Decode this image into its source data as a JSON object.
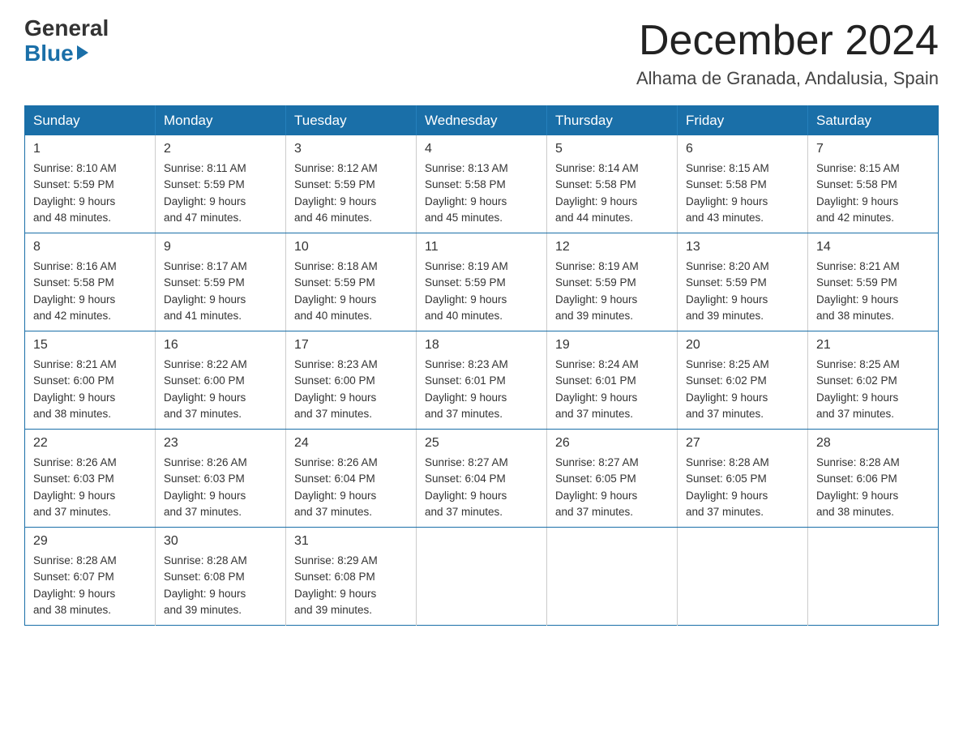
{
  "logo": {
    "line1": "General",
    "line2": "Blue"
  },
  "header": {
    "month": "December 2024",
    "location": "Alhama de Granada, Andalusia, Spain"
  },
  "days_of_week": [
    "Sunday",
    "Monday",
    "Tuesday",
    "Wednesday",
    "Thursday",
    "Friday",
    "Saturday"
  ],
  "weeks": [
    [
      {
        "day": "1",
        "sunrise": "8:10 AM",
        "sunset": "5:59 PM",
        "daylight": "9 hours and 48 minutes."
      },
      {
        "day": "2",
        "sunrise": "8:11 AM",
        "sunset": "5:59 PM",
        "daylight": "9 hours and 47 minutes."
      },
      {
        "day": "3",
        "sunrise": "8:12 AM",
        "sunset": "5:59 PM",
        "daylight": "9 hours and 46 minutes."
      },
      {
        "day": "4",
        "sunrise": "8:13 AM",
        "sunset": "5:58 PM",
        "daylight": "9 hours and 45 minutes."
      },
      {
        "day": "5",
        "sunrise": "8:14 AM",
        "sunset": "5:58 PM",
        "daylight": "9 hours and 44 minutes."
      },
      {
        "day": "6",
        "sunrise": "8:15 AM",
        "sunset": "5:58 PM",
        "daylight": "9 hours and 43 minutes."
      },
      {
        "day": "7",
        "sunrise": "8:15 AM",
        "sunset": "5:58 PM",
        "daylight": "9 hours and 42 minutes."
      }
    ],
    [
      {
        "day": "8",
        "sunrise": "8:16 AM",
        "sunset": "5:58 PM",
        "daylight": "9 hours and 42 minutes."
      },
      {
        "day": "9",
        "sunrise": "8:17 AM",
        "sunset": "5:59 PM",
        "daylight": "9 hours and 41 minutes."
      },
      {
        "day": "10",
        "sunrise": "8:18 AM",
        "sunset": "5:59 PM",
        "daylight": "9 hours and 40 minutes."
      },
      {
        "day": "11",
        "sunrise": "8:19 AM",
        "sunset": "5:59 PM",
        "daylight": "9 hours and 40 minutes."
      },
      {
        "day": "12",
        "sunrise": "8:19 AM",
        "sunset": "5:59 PM",
        "daylight": "9 hours and 39 minutes."
      },
      {
        "day": "13",
        "sunrise": "8:20 AM",
        "sunset": "5:59 PM",
        "daylight": "9 hours and 39 minutes."
      },
      {
        "day": "14",
        "sunrise": "8:21 AM",
        "sunset": "5:59 PM",
        "daylight": "9 hours and 38 minutes."
      }
    ],
    [
      {
        "day": "15",
        "sunrise": "8:21 AM",
        "sunset": "6:00 PM",
        "daylight": "9 hours and 38 minutes."
      },
      {
        "day": "16",
        "sunrise": "8:22 AM",
        "sunset": "6:00 PM",
        "daylight": "9 hours and 37 minutes."
      },
      {
        "day": "17",
        "sunrise": "8:23 AM",
        "sunset": "6:00 PM",
        "daylight": "9 hours and 37 minutes."
      },
      {
        "day": "18",
        "sunrise": "8:23 AM",
        "sunset": "6:01 PM",
        "daylight": "9 hours and 37 minutes."
      },
      {
        "day": "19",
        "sunrise": "8:24 AM",
        "sunset": "6:01 PM",
        "daylight": "9 hours and 37 minutes."
      },
      {
        "day": "20",
        "sunrise": "8:25 AM",
        "sunset": "6:02 PM",
        "daylight": "9 hours and 37 minutes."
      },
      {
        "day": "21",
        "sunrise": "8:25 AM",
        "sunset": "6:02 PM",
        "daylight": "9 hours and 37 minutes."
      }
    ],
    [
      {
        "day": "22",
        "sunrise": "8:26 AM",
        "sunset": "6:03 PM",
        "daylight": "9 hours and 37 minutes."
      },
      {
        "day": "23",
        "sunrise": "8:26 AM",
        "sunset": "6:03 PM",
        "daylight": "9 hours and 37 minutes."
      },
      {
        "day": "24",
        "sunrise": "8:26 AM",
        "sunset": "6:04 PM",
        "daylight": "9 hours and 37 minutes."
      },
      {
        "day": "25",
        "sunrise": "8:27 AM",
        "sunset": "6:04 PM",
        "daylight": "9 hours and 37 minutes."
      },
      {
        "day": "26",
        "sunrise": "8:27 AM",
        "sunset": "6:05 PM",
        "daylight": "9 hours and 37 minutes."
      },
      {
        "day": "27",
        "sunrise": "8:28 AM",
        "sunset": "6:05 PM",
        "daylight": "9 hours and 37 minutes."
      },
      {
        "day": "28",
        "sunrise": "8:28 AM",
        "sunset": "6:06 PM",
        "daylight": "9 hours and 38 minutes."
      }
    ],
    [
      {
        "day": "29",
        "sunrise": "8:28 AM",
        "sunset": "6:07 PM",
        "daylight": "9 hours and 38 minutes."
      },
      {
        "day": "30",
        "sunrise": "8:28 AM",
        "sunset": "6:08 PM",
        "daylight": "9 hours and 39 minutes."
      },
      {
        "day": "31",
        "sunrise": "8:29 AM",
        "sunset": "6:08 PM",
        "daylight": "9 hours and 39 minutes."
      },
      null,
      null,
      null,
      null
    ]
  ],
  "labels": {
    "sunrise": "Sunrise:",
    "sunset": "Sunset:",
    "daylight": "Daylight:"
  }
}
